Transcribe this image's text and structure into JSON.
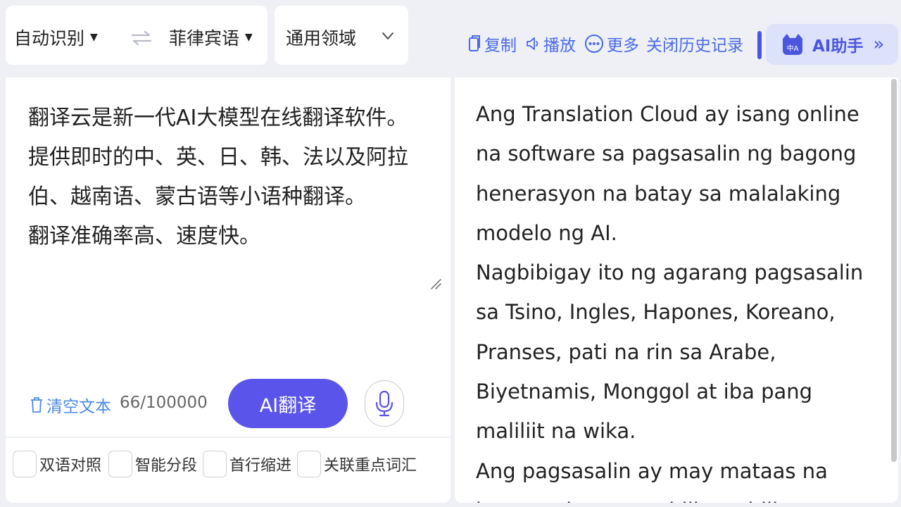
{
  "language_bar": {
    "source_lang": "自动识别",
    "target_lang": "菲律宾语",
    "domain": "通用领域"
  },
  "toolbar": {
    "copy_label": "复制",
    "play_label": "播放",
    "more_label": "更多",
    "close_history_label": "关闭历史记录",
    "ai_assistant_label": "AI助手",
    "ai_assistant_icon_text": "中A"
  },
  "source": {
    "lines": [
      "翻译云是新一代AI大模型在线翻译软件。",
      "提供即时的中、英、日、韩、法以及阿拉伯、越南语、蒙古语等小语种翻译。",
      "翻译准确率高、速度快。"
    ],
    "clear_label": "清空文本",
    "char_count": "66/100000",
    "translate_label": "AI翻译"
  },
  "options": [
    {
      "label": "双语对照",
      "checked": false
    },
    {
      "label": "智能分段",
      "checked": false
    },
    {
      "label": "首行缩进",
      "checked": false
    },
    {
      "label": "关联重点词汇",
      "checked": false
    }
  ],
  "output": {
    "paragraphs": [
      "Ang Translation Cloud ay isang online na software sa pagsasalin ng bagong henerasyon na batay sa malalaking modelo ng AI.",
      "Nagbibigay ito ng agarang pagsasalin sa Tsino, Ingles, Hapones, Koreano, Pranses, pati na rin sa Arabe, Biyetnamis, Monggol at iba pang maliliit na wika.",
      "Ang pagsasalin ay may mataas na katumpakan at mabilis na bilis."
    ]
  },
  "colors": {
    "accent": "#5a54ea",
    "link": "#4b6ae6",
    "background": "#eef0f5"
  }
}
